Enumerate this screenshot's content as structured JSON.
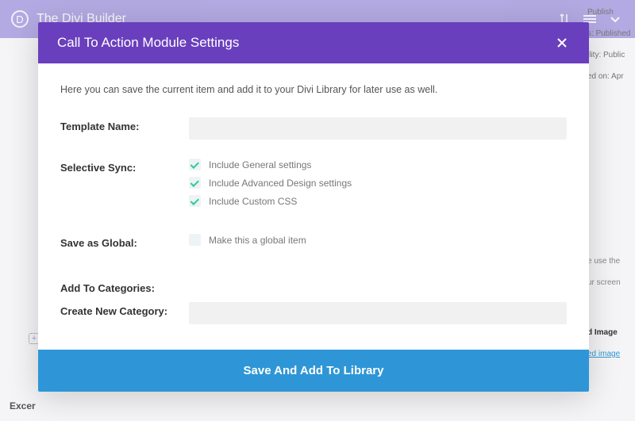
{
  "background": {
    "builder_title": "The Divi Builder",
    "publish": "Publish",
    "status": "Published",
    "visibility": "Public",
    "published_on": "ed on: Apr",
    "featured_image": "d Image",
    "featured_link": "ed image",
    "other": "e use the",
    "other2": "ur screen",
    "excerpt": "Excer"
  },
  "modal": {
    "title": "Call To Action Module Settings",
    "intro": "Here you can save the current item and add it to your Divi Library for later use as well.",
    "labels": {
      "template_name": "Template Name:",
      "selective_sync": "Selective Sync:",
      "save_global": "Save as Global:",
      "add_categories": "Add To Categories:",
      "create_category": "Create New Category:"
    },
    "sync_options": [
      {
        "label": "Include General settings",
        "checked": true
      },
      {
        "label": "Include Advanced Design settings",
        "checked": true
      },
      {
        "label": "Include Custom CSS",
        "checked": true
      }
    ],
    "global_option": {
      "label": "Make this a global item",
      "checked": false
    },
    "footer_button": "Save And Add To Library"
  }
}
